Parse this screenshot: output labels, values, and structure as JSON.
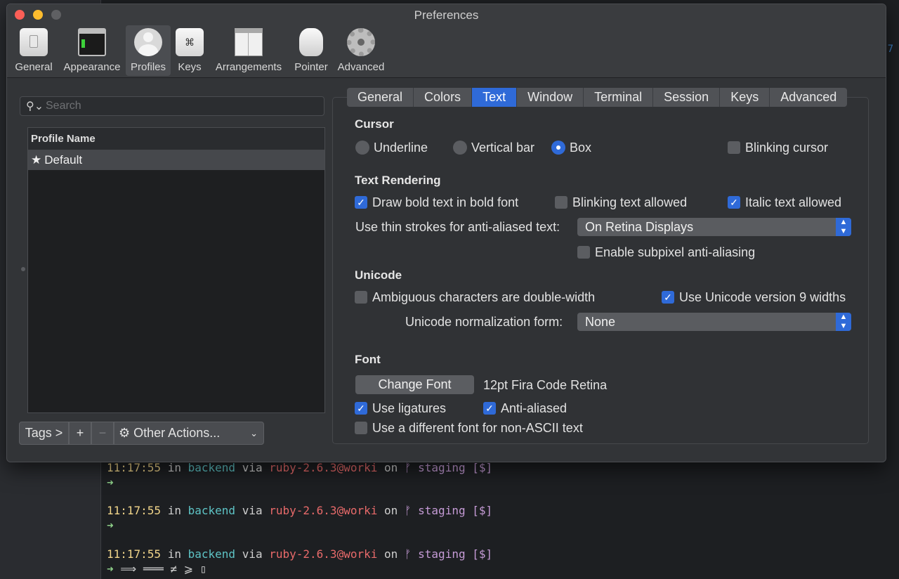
{
  "window": {
    "title": "Preferences"
  },
  "toolbar": {
    "items": [
      {
        "label": "General",
        "icon": "general-icon"
      },
      {
        "label": "Appearance",
        "icon": "appearance-icon"
      },
      {
        "label": "Profiles",
        "icon": "profiles-icon",
        "selected": true
      },
      {
        "label": "Keys",
        "icon": "keys-icon",
        "glyph": "⌘"
      },
      {
        "label": "Arrangements",
        "icon": "arrangements-icon"
      },
      {
        "label": "Pointer",
        "icon": "pointer-icon"
      },
      {
        "label": "Advanced",
        "icon": "advanced-icon"
      }
    ]
  },
  "sidebar": {
    "search_placeholder": "Search",
    "column_header": "Profile Name",
    "profiles": [
      {
        "name": "Default",
        "star": "★"
      }
    ],
    "tags_label": "Tags >",
    "add_label": "+",
    "remove_label": "−",
    "other_actions_label": "Other Actions...",
    "gear_glyph": "⚙",
    "chevron_glyph": "⌄"
  },
  "tabs": [
    "General",
    "Colors",
    "Text",
    "Window",
    "Terminal",
    "Session",
    "Keys",
    "Advanced"
  ],
  "active_tab": "Text",
  "cursor": {
    "title": "Cursor",
    "options": [
      "Underline",
      "Vertical bar",
      "Box"
    ],
    "selected": "Box",
    "blinking_label": "Blinking cursor",
    "blinking": false
  },
  "text_rendering": {
    "title": "Text Rendering",
    "bold_label": "Draw bold text in bold font",
    "bold": true,
    "blinking_text_label": "Blinking text allowed",
    "blinking_text": false,
    "italic_label": "Italic text allowed",
    "italic": true,
    "thin_strokes_label": "Use thin strokes for anti-aliased text:",
    "thin_strokes_value": "On Retina Displays",
    "subpixel_label": "Enable subpixel anti-aliasing",
    "subpixel": false
  },
  "unicode": {
    "title": "Unicode",
    "ambiguous_label": "Ambiguous characters are double-width",
    "ambiguous": false,
    "v9_label": "Use Unicode version 9 widths",
    "v9": true,
    "normalization_label": "Unicode normalization form:",
    "normalization_value": "None"
  },
  "font": {
    "title": "Font",
    "change_button": "Change Font",
    "current": "12pt Fira Code Retina",
    "ligatures_label": "Use ligatures",
    "ligatures": true,
    "antialiased_label": "Anti-aliased",
    "antialiased": true,
    "non_ascii_label": "Use a different font for non-ASCII text",
    "non_ascii": false
  },
  "check_glyph": "✓",
  "terminal": {
    "prompts": [
      {
        "time": "11:17:55",
        "in": "in",
        "dir": "backend",
        "via": "via",
        "ruby": "ruby-2.6.3@worki",
        "on": "on",
        "branch_icon": "ᚠ",
        "branch": "staging [$]",
        "arrow": "➜",
        "extra": ""
      },
      {
        "time": "11:17:55",
        "in": "in",
        "dir": "backend",
        "via": "via",
        "ruby": "ruby-2.6.3@worki",
        "on": "on",
        "branch_icon": "ᚠ",
        "branch": "staging [$]",
        "arrow": "➜",
        "extra": ""
      },
      {
        "time": "11:17:55",
        "in": "in",
        "dir": "backend",
        "via": "via",
        "ruby": "ruby-2.6.3@worki",
        "on": "on",
        "branch_icon": "ᚠ",
        "branch": "staging [$]",
        "arrow": "➜",
        "extra": " ⟹ ═══ ≠ ⩾ ▯"
      }
    ],
    "edge_text": "7"
  }
}
